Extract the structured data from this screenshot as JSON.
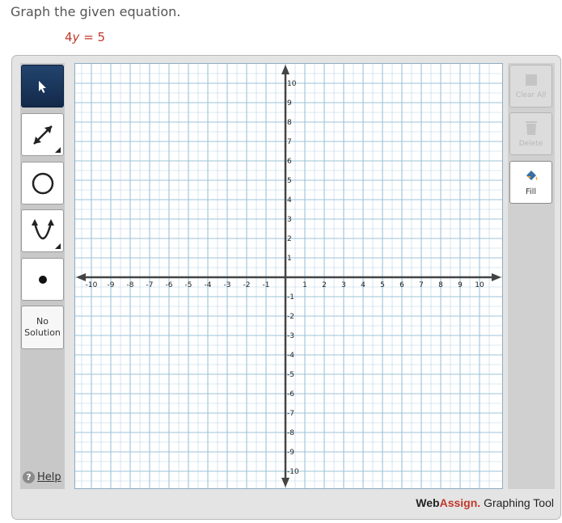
{
  "prompt": "Graph the given equation.",
  "equation": {
    "coef": "4",
    "var": "y",
    "rest": " = 5"
  },
  "tools": {
    "no_solution_line1": "No",
    "no_solution_line2": "Solution",
    "help_label": "Help",
    "clear_all_label": "Clear All",
    "delete_label": "Delete",
    "fill_label": "Fill"
  },
  "brand": {
    "web": "Web",
    "assign": "Assign.",
    "suffix": " Graphing Tool"
  },
  "graph": {
    "x_range": [
      -10,
      10
    ],
    "y_range": [
      -10,
      10
    ],
    "minor_step": 0.5,
    "major_step": 1,
    "x_tick_labels": [
      "-10",
      "-9",
      "-8",
      "-7",
      "-6",
      "-5",
      "-4",
      "-3",
      "-2",
      "-1",
      "1",
      "2",
      "3",
      "4",
      "5",
      "6",
      "7",
      "8",
      "9",
      "10"
    ],
    "y_tick_labels": [
      "10",
      "9",
      "8",
      "7",
      "6",
      "5",
      "4",
      "3",
      "2",
      "1",
      "-1",
      "-2",
      "-3",
      "-4",
      "-5",
      "-6",
      "-7",
      "-8",
      "-9",
      "-10"
    ],
    "grid_color": "#9cc3da",
    "axis_color": "#444444"
  }
}
